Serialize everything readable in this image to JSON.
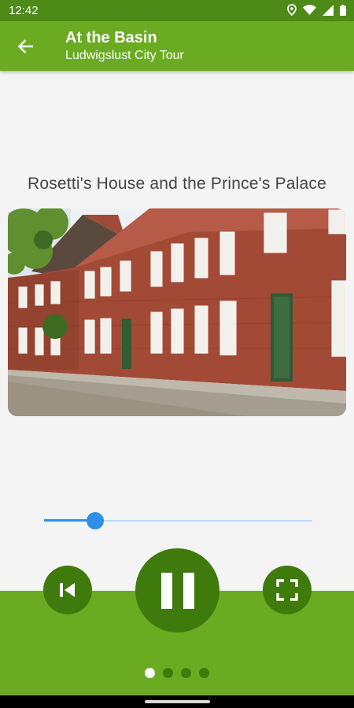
{
  "status_bar": {
    "time": "12:42"
  },
  "app_bar": {
    "title": "At the Basin",
    "subtitle": "Ludwigslust City Tour"
  },
  "content": {
    "title": "Rosetti's House and the Prince's Palace"
  },
  "player": {
    "progress": 0.19,
    "state": "playing"
  },
  "pager": {
    "pages": 4,
    "active_index": 0
  },
  "colors": {
    "status_bar": "#4e8a17",
    "app_bar": "#6aab22",
    "button": "#3f7a0c",
    "slider_accent": "#2d8fe8",
    "slider_track": "#b9dcfa"
  },
  "icons": {
    "status": [
      "location-icon",
      "wifi-icon",
      "signal-icon",
      "battery-icon"
    ],
    "back": "arrow-left-icon",
    "previous": "skip-previous-icon",
    "pause": "pause-icon",
    "fullscreen": "fullscreen-icon"
  }
}
